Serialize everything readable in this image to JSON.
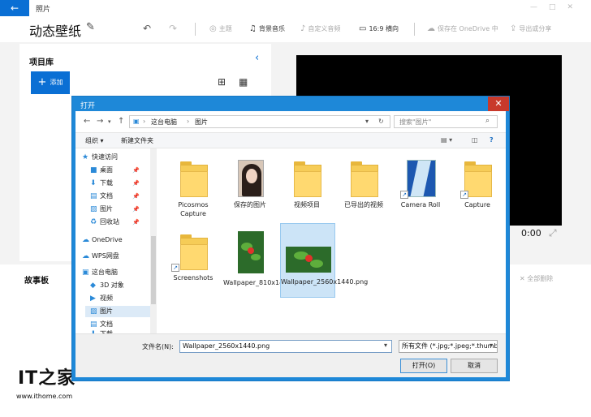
{
  "app": {
    "title": "照片",
    "project_title": "动态壁纸",
    "toolbar": {
      "theme": "主题",
      "music": "背景音乐",
      "custom_audio": "自定义音频",
      "aspect": "16:9 横向",
      "save_onedrive": "保存在 OneDrive 中",
      "export": "导出或分享"
    },
    "library": {
      "title": "项目库",
      "add_label": "添加"
    },
    "timecode": "0:00",
    "storyboard": {
      "title": "故事板",
      "delete_all": "全部删除"
    }
  },
  "dialog": {
    "title": "打开",
    "breadcrumbs": [
      "这台电脑",
      "图片"
    ],
    "search_placeholder": "搜索\"图片\"",
    "commands": {
      "organize": "组织 ▾",
      "new_folder": "新建文件夹"
    },
    "nav": [
      {
        "label": "快速访问",
        "icon": "star-icon"
      },
      {
        "label": "桌面",
        "icon": "desktop-icon",
        "pinned": true
      },
      {
        "label": "下载",
        "icon": "download-icon",
        "pinned": true
      },
      {
        "label": "文档",
        "icon": "document-icon",
        "pinned": true
      },
      {
        "label": "图片",
        "icon": "picture-icon",
        "pinned": true
      },
      {
        "label": "回收站",
        "icon": "recycle-bin-icon",
        "pinned": true
      },
      {
        "label": "OneDrive",
        "icon": "cloud-icon"
      },
      {
        "label": "WPS网盘",
        "icon": "wps-cloud-icon"
      },
      {
        "label": "这台电脑",
        "icon": "computer-icon"
      },
      {
        "label": "3D 对象",
        "icon": "cube-icon"
      },
      {
        "label": "视频",
        "icon": "video-icon"
      },
      {
        "label": "图片",
        "icon": "picture-icon",
        "selected": true
      },
      {
        "label": "文档",
        "icon": "document-icon"
      },
      {
        "label": "下载",
        "icon": "download-icon"
      }
    ],
    "files": [
      {
        "label": "Picosmos Capture",
        "kind": "folder"
      },
      {
        "label": "保存的图片",
        "kind": "folder-photo"
      },
      {
        "label": "视频项目",
        "kind": "folder"
      },
      {
        "label": "已导出的视频",
        "kind": "folder"
      },
      {
        "label": "Camera Roll",
        "kind": "folder-camera",
        "shortcut": true
      },
      {
        "label": "Capture",
        "kind": "folder",
        "shortcut": true
      },
      {
        "label": "Screenshots",
        "kind": "folder",
        "shortcut": true
      },
      {
        "label": "Wallpaper_810x1440.png",
        "kind": "image-tall"
      },
      {
        "label": "Wallpaper_2560x1440.png",
        "kind": "image-wide",
        "selected": true
      }
    ],
    "filename_label": "文件名(N):",
    "filename_value": "Wallpaper_2560x1440.png",
    "filetype": "所有文件 (*.jpg;*.jpeg;*.thumb",
    "open_button": "打开(O)",
    "cancel_button": "取消"
  },
  "watermark": {
    "logo": "IT之家",
    "url": "www.ithome.com"
  }
}
